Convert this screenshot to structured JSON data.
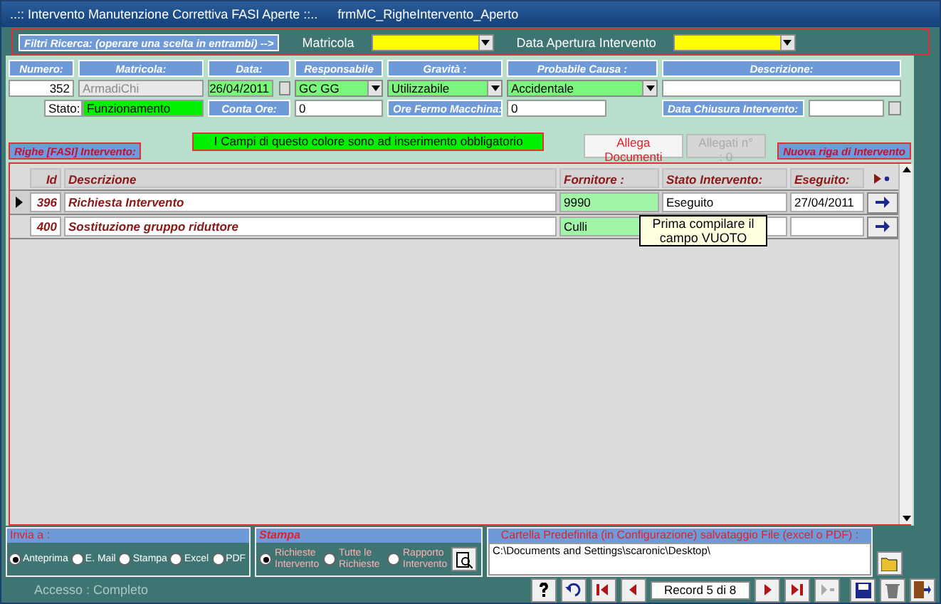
{
  "window": {
    "title": "..:: Intervento Manutenzione Correttiva FASI Aperte ::..",
    "form_name": "frmMC_RigheIntervento_Aperto"
  },
  "filters": {
    "label": "Filtri Ricerca:  (operare una scelta in  entrambi) -->",
    "fields": [
      {
        "label": "Matricola"
      },
      {
        "label": "Data Apertura Intervento"
      }
    ]
  },
  "header_fields": [
    {
      "label": "Numero:",
      "value": "352",
      "kind": "number",
      "required": false
    },
    {
      "label": "Matricola:",
      "value": "ArmadiChi",
      "kind": "disabled",
      "required": false
    },
    {
      "label": "Data:",
      "value": "26/04/2011",
      "kind": "date",
      "required": true
    },
    {
      "label": "Responsabile",
      "value": "GC GG",
      "kind": "combo",
      "required": true
    },
    {
      "label": "Gravità :",
      "value": "Utilizzabile",
      "kind": "combo",
      "required": true
    },
    {
      "label": "Probabile Causa :",
      "value": "Accidentale",
      "kind": "combo",
      "required": true
    },
    {
      "label": "Descrizione:",
      "kind": "text",
      "required": false
    }
  ],
  "stato": {
    "label": "Stato:",
    "value": "Funzionamento"
  },
  "conta_ore": {
    "label": "Conta Ore:",
    "value": "0"
  },
  "ore_fermo": {
    "label": "Ore Fermo Macchina:",
    "value": "0"
  },
  "data_chiusura": {
    "label": "Data Chiusura Intervento:"
  },
  "required_note": "I Campi di questo colore sono ad inserimento obbligatorio",
  "buttons": [
    {
      "label": "Allega Documenti",
      "disabled": false
    },
    {
      "label": "Allegati n° : 0",
      "disabled": true
    }
  ],
  "righe_label": "Righe [FASI] Intervento:",
  "nuova_riga_label": "Nuova riga di Intervento",
  "table": {
    "columns": [
      "Id",
      "Descrizione",
      "Fornitore :",
      "Stato Intervento:",
      "Eseguito:"
    ],
    "rows": [
      {
        "selected": true,
        "id": "396",
        "descrizione": "Richiesta Intervento",
        "fornitore": "9990",
        "stato": "Eseguito",
        "eseguito": "27/04/2011"
      },
      {
        "selected": false,
        "id": "400",
        "descrizione": "Sostituzione gruppo  riduttore",
        "fornitore": "Culli",
        "stato": "",
        "eseguito": ""
      }
    ]
  },
  "tooltip": "Prima compilare il campo VUOTO",
  "invia_a": {
    "label": "Invia a :",
    "options": [
      {
        "label": "Anteprima",
        "selected": true
      },
      {
        "label": "E. Mail",
        "selected": false
      },
      {
        "label": "Stampa",
        "selected": false
      },
      {
        "label": "Excel",
        "selected": false
      },
      {
        "label": "PDF",
        "selected": false
      }
    ]
  },
  "stampa": {
    "label": "Stampa",
    "options": [
      {
        "label": "Richieste Intervento",
        "selected": true
      },
      {
        "label": "Tutte le Richieste",
        "selected": false
      },
      {
        "label": "Rapporto Intervento",
        "selected": false
      }
    ]
  },
  "cartella": {
    "label": "Cartella Predefinita  (in Configurazione) salvataggio File (excel o PDF) :",
    "value": "C:\\Documents and Settings\\scaronic\\Desktop\\"
  },
  "status": "Accesso : Completo",
  "record": "Record 5 di 8"
}
